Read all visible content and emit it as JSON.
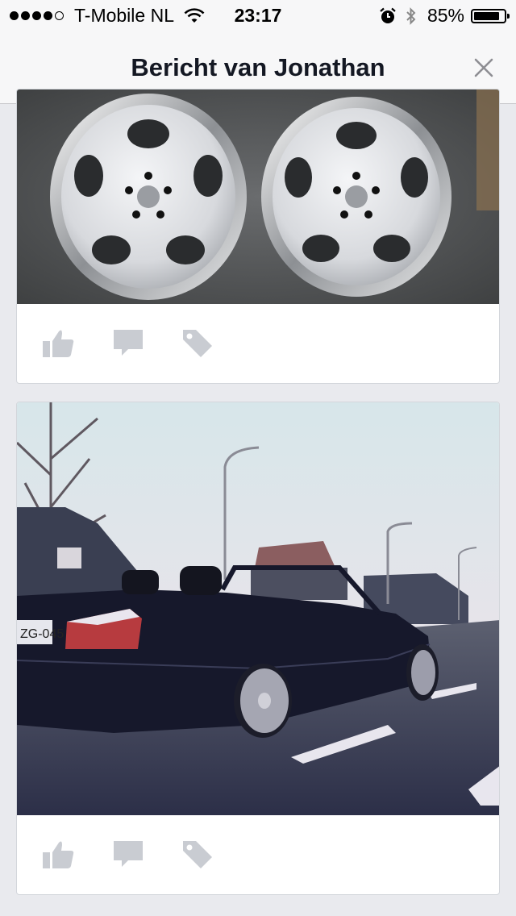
{
  "status_bar": {
    "carrier": "T-Mobile NL",
    "time": "23:17",
    "battery_percent": "85%",
    "battery_level": 0.85,
    "signal_bars": 4,
    "signal_max": 5,
    "icons": [
      "wifi-icon",
      "alarm-icon",
      "bluetooth-icon",
      "battery-icon"
    ]
  },
  "nav": {
    "title": "Bericht van Jonathan",
    "close_icon": "close-icon"
  },
  "posts": [
    {
      "image": "photo of two silver multi-piece alloy wheels",
      "actions": [
        "like-icon",
        "comment-icon",
        "tag-icon"
      ]
    },
    {
      "image": "photo of a dark convertible car on a street",
      "actions": [
        "like-icon",
        "comment-icon",
        "tag-icon"
      ]
    }
  ],
  "colors": {
    "background": "#e9eaee",
    "bar": "#f7f7f8",
    "icon_gray": "#c9ccd2",
    "text": "#141823"
  }
}
